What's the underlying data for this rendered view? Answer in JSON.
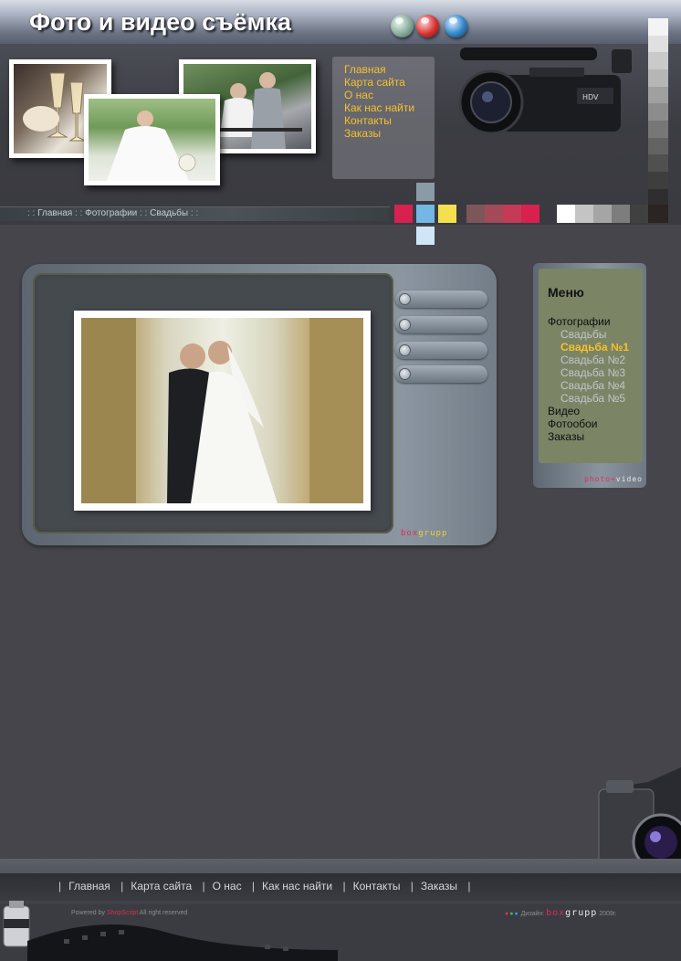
{
  "header": {
    "title": "Фото и видео съёмка",
    "nav_links": [
      "Главная",
      "Карта сайта",
      "О нас",
      "Как нас найти",
      "Контакты",
      "Заказы"
    ],
    "breadcrumb": {
      "sep": ": :",
      "items": [
        "Главная",
        "Фотографии",
        "Свадьбы"
      ]
    },
    "swatch_colors": [
      "#d8214f",
      "#74b6e4",
      "#f4e04f",
      "#7d5659",
      "#a34a59",
      "#c43a57",
      "#d8214f",
      "#ffffff",
      "#c4c4c4",
      "#a5a5a5",
      "#7d7d7d",
      "#404040",
      "#2a2422"
    ],
    "gray_strip": [
      "#f4f4f4",
      "#e0e0e0",
      "#cacaca",
      "#b6b6b6",
      "#a0a0a0",
      "#8c8c8c",
      "#777777",
      "#636363",
      "#505050",
      "#3e3e3e",
      "#2e2e2e",
      "#1e1a18"
    ]
  },
  "menu": {
    "title": "Меню",
    "items": [
      {
        "label": "Фотографии",
        "level": 0,
        "active": false
      },
      {
        "label": "Свадьбы",
        "level": 1,
        "active": false
      },
      {
        "label": "Свадьба №1",
        "level": 1,
        "active": true
      },
      {
        "label": "Свадьба №2",
        "level": 1,
        "active": false
      },
      {
        "label": "Свадьба №3",
        "level": 1,
        "active": false
      },
      {
        "label": "Свадьба №4",
        "level": 1,
        "active": false
      },
      {
        "label": "Свадьба №5",
        "level": 1,
        "active": false
      },
      {
        "label": "Видео",
        "level": 0,
        "active": false
      },
      {
        "label": "Фотообои",
        "level": 0,
        "active": false
      },
      {
        "label": "Заказы",
        "level": 0,
        "active": false
      }
    ],
    "brand_a": "photo",
    "brand_b": "video"
  },
  "tv": {
    "brand_a": "box",
    "brand_b": "grupp",
    "buttons": 4
  },
  "footer": {
    "nav_links": [
      "Главная",
      "Карта сайта",
      "О нас",
      "Как нас найти",
      "Контакты",
      "Заказы"
    ],
    "sep": "|",
    "powered_prefix": "Powered by",
    "powered_highlight": "ShopScript",
    "powered_suffix": "All right reserved",
    "design_label": "Дизайн:",
    "design_brand_a": "box",
    "design_brand_b": "grupp",
    "design_year": "2009г."
  },
  "colors": {
    "accent_yellow": "#f6c12b",
    "brand_pink": "#e02b5a",
    "background": "#45454b"
  }
}
